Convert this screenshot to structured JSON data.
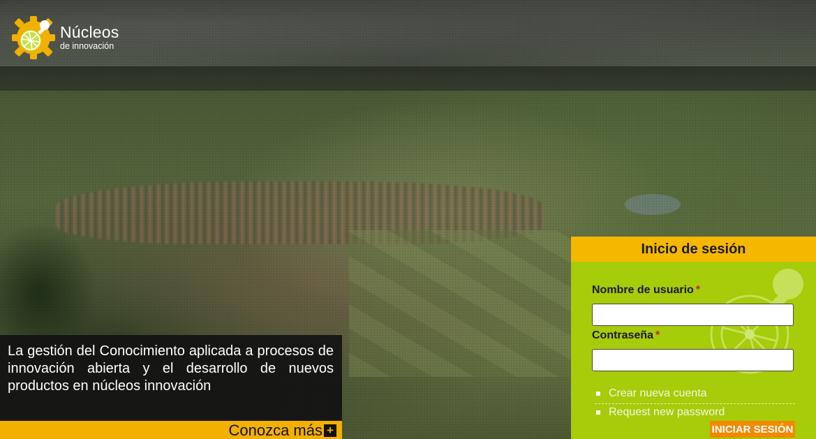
{
  "brand": {
    "name": "Núcleos",
    "subtitle": "de innovación",
    "logo_icon": "gear-lightbulb-icon",
    "accent_color": "#f2b000"
  },
  "hero": {
    "tagline": "La gestión del Conocimiento aplicada a procesos de innovación abierta y el desarrollo de nuevos productos en núcleos innovación",
    "more_label": "Conozca más",
    "more_icon": "plus-icon",
    "more_plus": "+"
  },
  "login": {
    "title": "Inicio de sesión",
    "username_label": "Nombre de usuario",
    "password_label": "Contraseña",
    "required_marker": "*",
    "username_value": "",
    "password_value": "",
    "links": [
      {
        "label": "Crear nueva cuenta"
      },
      {
        "label": "Request new password"
      }
    ],
    "submit_label": "INICIAR SESIÓN",
    "panel_color": "#a6cc0a",
    "header_color": "#f5b700",
    "button_color": "#f28a00"
  }
}
